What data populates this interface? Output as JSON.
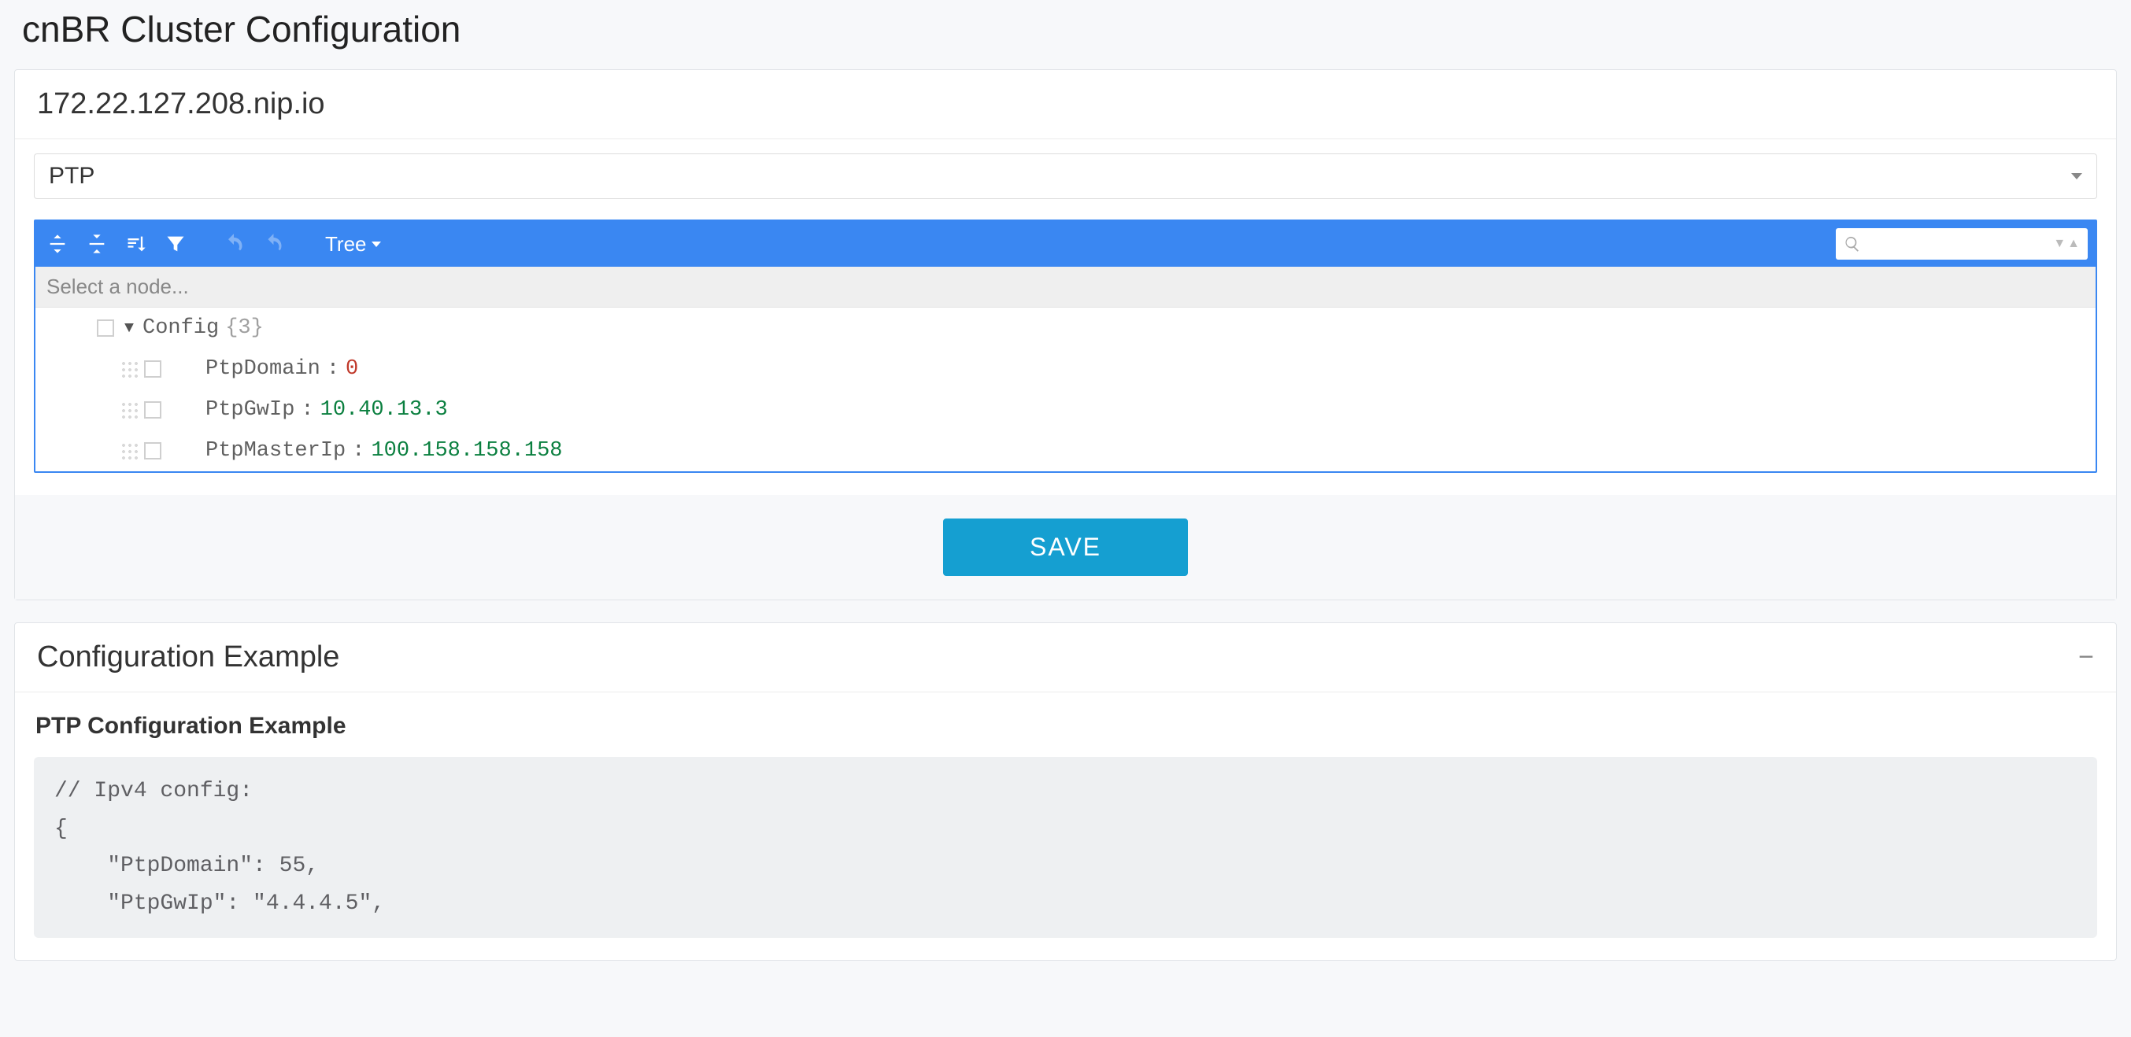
{
  "page_title": "cnBR Cluster Configuration",
  "host_address": "172.22.127.208.nip.io",
  "config_type_select": {
    "value": "PTP"
  },
  "editor": {
    "mode_label": "Tree",
    "path_placeholder": "Select a node...",
    "search_placeholder": "",
    "tree": {
      "root_key": "Config",
      "root_count": "{3}",
      "items": [
        {
          "key": "PtpDomain",
          "value": "0",
          "type": "num"
        },
        {
          "key": "PtpGwIp",
          "value": "10.40.13.3",
          "type": "str"
        },
        {
          "key": "PtpMasterIp",
          "value": "100.158.158.158",
          "type": "str"
        }
      ]
    }
  },
  "save_button_label": "SAVE",
  "example_panel_title": "Configuration Example",
  "example_subtitle": "PTP Configuration Example",
  "example_code": "// Ipv4 config:\n{\n    \"PtpDomain\": 55,\n    \"PtpGwIp\": \"4.4.4.5\","
}
